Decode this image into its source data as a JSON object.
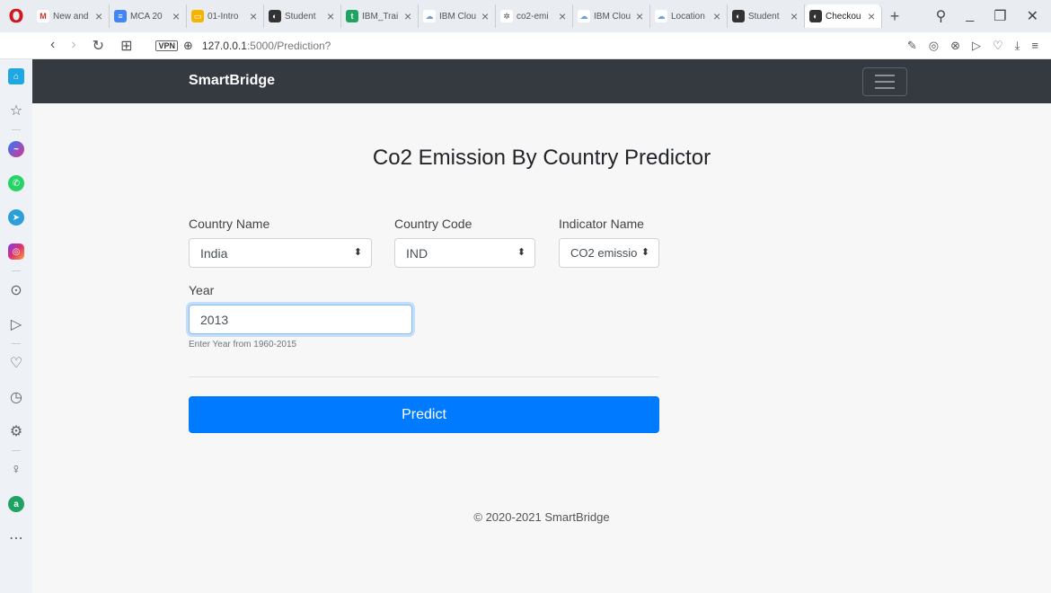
{
  "browser": {
    "tabs": [
      {
        "label": "New and",
        "fav_color": "#ffffff",
        "fav_text": "M",
        "fav_text_color": "#d93025"
      },
      {
        "label": "MCA 20",
        "fav_color": "#4285f4",
        "fav_text": "≡",
        "fav_text_color": "#ffffff"
      },
      {
        "label": "01-Intro",
        "fav_color": "#f4b400",
        "fav_text": "▭",
        "fav_text_color": "#ffffff"
      },
      {
        "label": "Student",
        "fav_color": "#333333",
        "fav_text": "◐",
        "fav_text_color": "#ffffff"
      },
      {
        "label": "IBM_Trai",
        "fav_color": "#1ea362",
        "fav_text": "t",
        "fav_text_color": "#ffffff"
      },
      {
        "label": "IBM Clou",
        "fav_color": "#ffffff",
        "fav_text": "☁",
        "fav_text_color": "#6aa0e0"
      },
      {
        "label": "co2-emi",
        "fav_color": "#ffffff",
        "fav_text": "✲",
        "fav_text_color": "#555555"
      },
      {
        "label": "IBM Clou",
        "fav_color": "#ffffff",
        "fav_text": "☁",
        "fav_text_color": "#6aa0e0"
      },
      {
        "label": "Location",
        "fav_color": "#ffffff",
        "fav_text": "☁",
        "fav_text_color": "#6aa0e0"
      },
      {
        "label": "Student",
        "fav_color": "#333333",
        "fav_text": "◐",
        "fav_text_color": "#ffffff"
      },
      {
        "label": "Checkou",
        "fav_color": "#333333",
        "fav_text": "◐",
        "fav_text_color": "#ffffff",
        "active": true
      }
    ],
    "url_host": "127.0.0.1",
    "url_path": ":5000/Prediction?",
    "vpn_label": "VPN"
  },
  "page": {
    "brand": "SmartBridge",
    "title": "Co2 Emission By Country Predictor",
    "form": {
      "country_name_label": "Country Name",
      "country_name_value": "India",
      "country_code_label": "Country Code",
      "country_code_value": "IND",
      "indicator_label": "Indicator Name",
      "indicator_value": "CO2 emissio",
      "year_label": "Year",
      "year_value": "2013",
      "year_hint": "Enter Year from 1960-2015",
      "predict_label": "Predict"
    },
    "footer": "© 2020-2021 SmartBridge"
  },
  "colors": {
    "navbar": "#343a40",
    "primary": "#007bff"
  }
}
